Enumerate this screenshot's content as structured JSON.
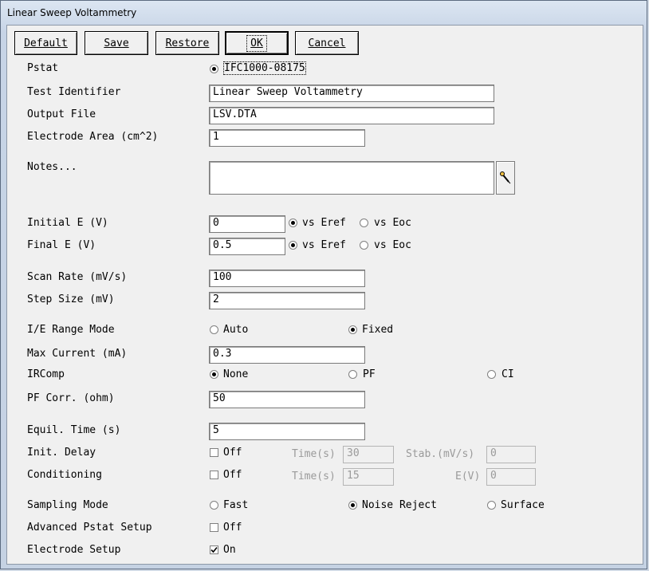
{
  "window": {
    "title": "Linear Sweep Voltammetry"
  },
  "buttons": {
    "default": "Default",
    "save": "Save",
    "restore": "Restore",
    "ok": "OK",
    "cancel": "Cancel"
  },
  "pstat": {
    "label": "Pstat",
    "option": "IFC1000-08175"
  },
  "test_identifier": {
    "label": "Test Identifier",
    "value": "Linear Sweep Voltammetry"
  },
  "output_file": {
    "label": "Output File",
    "value": "LSV.DTA"
  },
  "electrode_area": {
    "label": "Electrode Area (cm^2)",
    "value": "1"
  },
  "notes": {
    "label": "Notes...",
    "value": ""
  },
  "initial_e": {
    "label": "Initial E (V)",
    "value": "0",
    "opt1": "vs Eref",
    "opt2": "vs Eoc"
  },
  "final_e": {
    "label": "Final E (V)",
    "value": "0.5",
    "opt1": "vs Eref",
    "opt2": "vs Eoc"
  },
  "scan_rate": {
    "label": "Scan Rate (mV/s)",
    "value": "100"
  },
  "step_size": {
    "label": "Step Size (mV)",
    "value": "2"
  },
  "ie_range_mode": {
    "label": "I/E Range Mode",
    "opt1": "Auto",
    "opt2": "Fixed"
  },
  "max_current": {
    "label": "Max Current (mA)",
    "value": "0.3"
  },
  "ircomp": {
    "label": "IRComp",
    "opt1": "None",
    "opt2": "PF",
    "opt3": "CI"
  },
  "pf_corr": {
    "label": "PF Corr. (ohm)",
    "value": "50"
  },
  "equil_time": {
    "label": "Equil. Time (s)",
    "value": "5"
  },
  "init_delay": {
    "label": "Init. Delay",
    "check": "Off",
    "time_label": "Time(s)",
    "time_value": "30",
    "stab_label": "Stab.(mV/s)",
    "stab_value": "0"
  },
  "conditioning": {
    "label": "Conditioning",
    "check": "Off",
    "time_label": "Time(s)",
    "time_value": "15",
    "e_label": "E(V)",
    "e_value": "0"
  },
  "sampling_mode": {
    "label": "Sampling Mode",
    "opt1": "Fast",
    "opt2": "Noise Reject",
    "opt3": "Surface"
  },
  "advanced_pstat": {
    "label": "Advanced Pstat Setup",
    "check": "Off"
  },
  "electrode_setup": {
    "label": "Electrode Setup",
    "check": "On"
  }
}
